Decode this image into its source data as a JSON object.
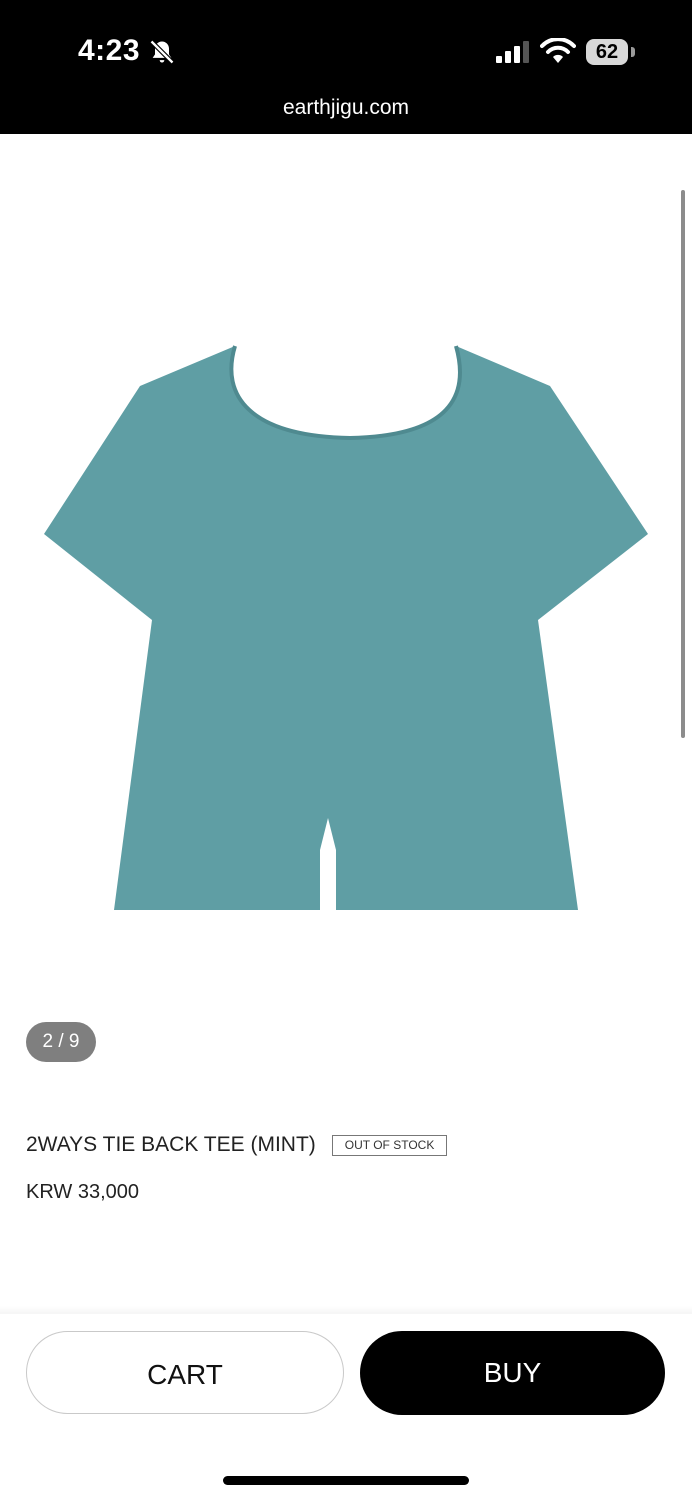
{
  "status_bar": {
    "time": "4:23",
    "battery_level": "62",
    "icons": [
      "bell-muted-icon",
      "cellular-signal-icon",
      "wifi-icon",
      "battery-icon"
    ]
  },
  "browser": {
    "url": "earthjigu.com"
  },
  "product": {
    "image_counter": "2 / 9",
    "title": "2WAYS TIE BACK TEE (MINT)",
    "stock_badge": "OUT OF STOCK",
    "price": "KRW 33,000",
    "image_color": "#5f9ea4"
  },
  "actions": {
    "cart_label": "CART",
    "buy_label": "BUY"
  }
}
